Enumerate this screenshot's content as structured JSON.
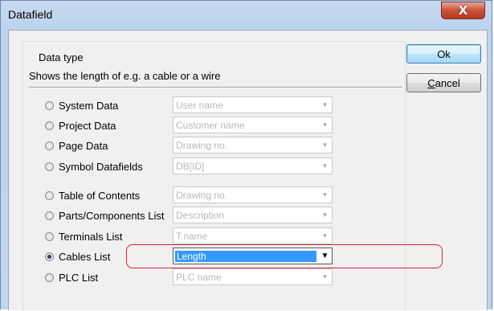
{
  "window": {
    "title": "Datafield",
    "close_glyph": "X"
  },
  "group": {
    "label": "Data type",
    "description": "Shows the length of e.g. a cable or a wire"
  },
  "buttons": {
    "ok": "Ok",
    "cancel": "Cancel"
  },
  "options": [
    {
      "label": "System Data",
      "selected": false,
      "combo": "User name"
    },
    {
      "label": "Project Data",
      "selected": false,
      "combo": "Customer name"
    },
    {
      "label": "Page Data",
      "selected": false,
      "combo": "Drawing no."
    },
    {
      "label": "Symbol Datafields",
      "selected": false,
      "combo": "DB[ID]"
    },
    {
      "label": "Table of Contents",
      "selected": false,
      "combo": "Drawing no."
    },
    {
      "label": "Parts/Components List",
      "selected": false,
      "combo": "Description"
    },
    {
      "label": "Terminals List",
      "selected": false,
      "combo": "T.name"
    },
    {
      "label": "Cables List",
      "selected": true,
      "combo": "Length"
    },
    {
      "label": "PLC List",
      "selected": false,
      "combo": "PLC name"
    }
  ],
  "colors": {
    "highlight": "#d9232a",
    "selection": "#3399ff",
    "close": "#c9513a"
  }
}
